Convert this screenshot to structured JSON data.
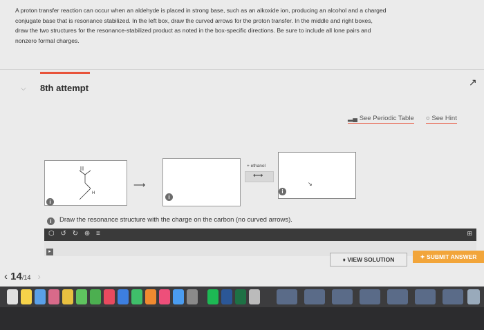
{
  "question": {
    "line1": "A proton transfer reaction can occur when an aldehyde is placed in strong base, such as an alkoxide ion, producing an alcohol and a charged",
    "line2": "conjugate base that is resonance stabilized. In the left box, draw the curved arrows for the proton transfer. In the middle and right boxes,",
    "line3": "draw the two structures for the resonance-stabilized product as noted in the box-specific directions. Be sure to include all lone pairs and",
    "line4": "nonzero formal charges."
  },
  "attempt": {
    "label": "8th attempt",
    "chevron": "chevron-down-icon",
    "collapse": "arrow-up-icon"
  },
  "links": {
    "periodic_table": "See Periodic Table",
    "hint": "See Hint"
  },
  "reaction": {
    "arrow_label": "+ ethanol",
    "forward_arrow": "⟶",
    "equilibrium_arrow": "⟷"
  },
  "badges": {
    "box1": "i",
    "box2": "i",
    "box3": "i",
    "instruction": "i"
  },
  "instruction": "Draw the resonance structure with the charge on the carbon (no curved arrows).",
  "toolbar": {
    "icons": "⬡ ↺ ↻ ⊕ ≡",
    "right": "⊞"
  },
  "buttons": {
    "view_solution": "♦ VIEW SOLUTION",
    "submit_answer": "✦ SUBMIT ANSWER"
  },
  "pager": {
    "prev": "‹",
    "current": "14",
    "total": "/14",
    "next": "›"
  },
  "colors": {
    "accent": "#e8533a",
    "submit": "#f2a53a",
    "toolbar": "#3a3a3a"
  }
}
